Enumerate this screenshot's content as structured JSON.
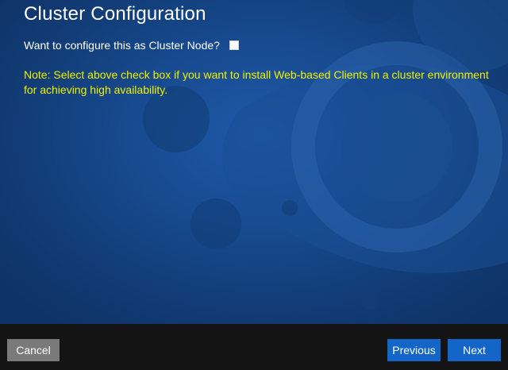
{
  "page": {
    "title": "Cluster Configuration"
  },
  "cluster": {
    "question": "Want to configure this as Cluster Node?",
    "checked": false,
    "note": "Note: Select above check box if you want to install Web-based Clients in a cluster environment for achieving high availability."
  },
  "footer": {
    "cancel_label": "Cancel",
    "previous_label": "Previous",
    "next_label": "Next"
  },
  "colors": {
    "background": "#174a8f",
    "note_text": "#f2f200",
    "primary_button": "#1366c8",
    "cancel_button": "#7a7a7a",
    "footer_bar": "#141414"
  }
}
